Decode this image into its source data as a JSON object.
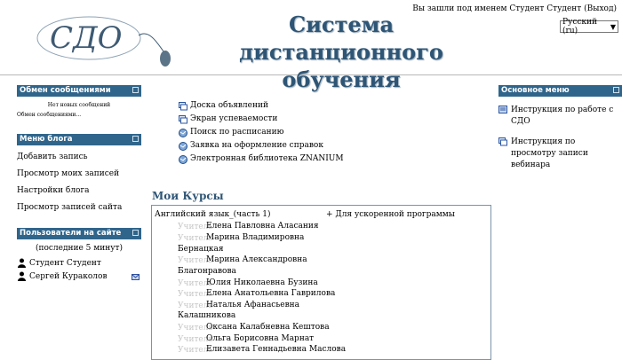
{
  "header": {
    "logo_text": "СДО",
    "title_line1": "Система",
    "title_line2": "дистанционного обучения",
    "login_prefix": "Вы зашли под именем",
    "user_name": "Студент Студент",
    "logout_label": "(Выход)",
    "language": "Русский (ru)"
  },
  "messages_block": {
    "title": "Обмен сообщениями",
    "no_new": "Нет новых сообщений",
    "link": "Обмен сообщениями..."
  },
  "blog_menu": {
    "title": "Меню блога",
    "items": [
      "Добавить запись",
      "Просмотр моих записей",
      "Настройки блога",
      "Просмотр записей сайта"
    ]
  },
  "online_users": {
    "title": "Пользователи на сайте",
    "period": "(последние 5 минут)",
    "users": [
      "Студент Студент",
      "Сергей Кураколов"
    ]
  },
  "main_menu": {
    "title": "Основное меню",
    "items": [
      "Инструкция по работе с СДО",
      "Инструкция по просмотру записи вебинара"
    ]
  },
  "center_links": [
    {
      "label": "Доска объявлений",
      "icon": "forum-icon"
    },
    {
      "label": "Экран успеваемости",
      "icon": "forum-icon"
    },
    {
      "label": "Поиск по расписанию",
      "icon": "web-link-icon"
    },
    {
      "label": "Заявка на оформление справок",
      "icon": "web-link-icon"
    },
    {
      "label": "Электронная библиотека ZNANIUM",
      "icon": "web-link-icon"
    }
  ],
  "courses": {
    "title": "Мои Курсы",
    "course_name": "Английский язык_(часть 1)",
    "course_note": "+ Для ускоренной программы",
    "role_label": "Учитель",
    "teachers": [
      "Елена Павловна Аласания",
      "Марина Владимировна",
      "Бернацкая",
      "Марина Александровна",
      "Благонравова",
      "Юлия Николаевна Бузина",
      "Елена Анатольевна Гаврилова",
      "Наталья Афанасьевна",
      "Калашникова",
      "Оксана Калабневна Кештова",
      "Ольга Борисовна Марнат",
      "Елизавета Геннадьевна Маслова"
    ]
  },
  "colors": {
    "block_header": "#30658b",
    "title": "#2e5575"
  }
}
